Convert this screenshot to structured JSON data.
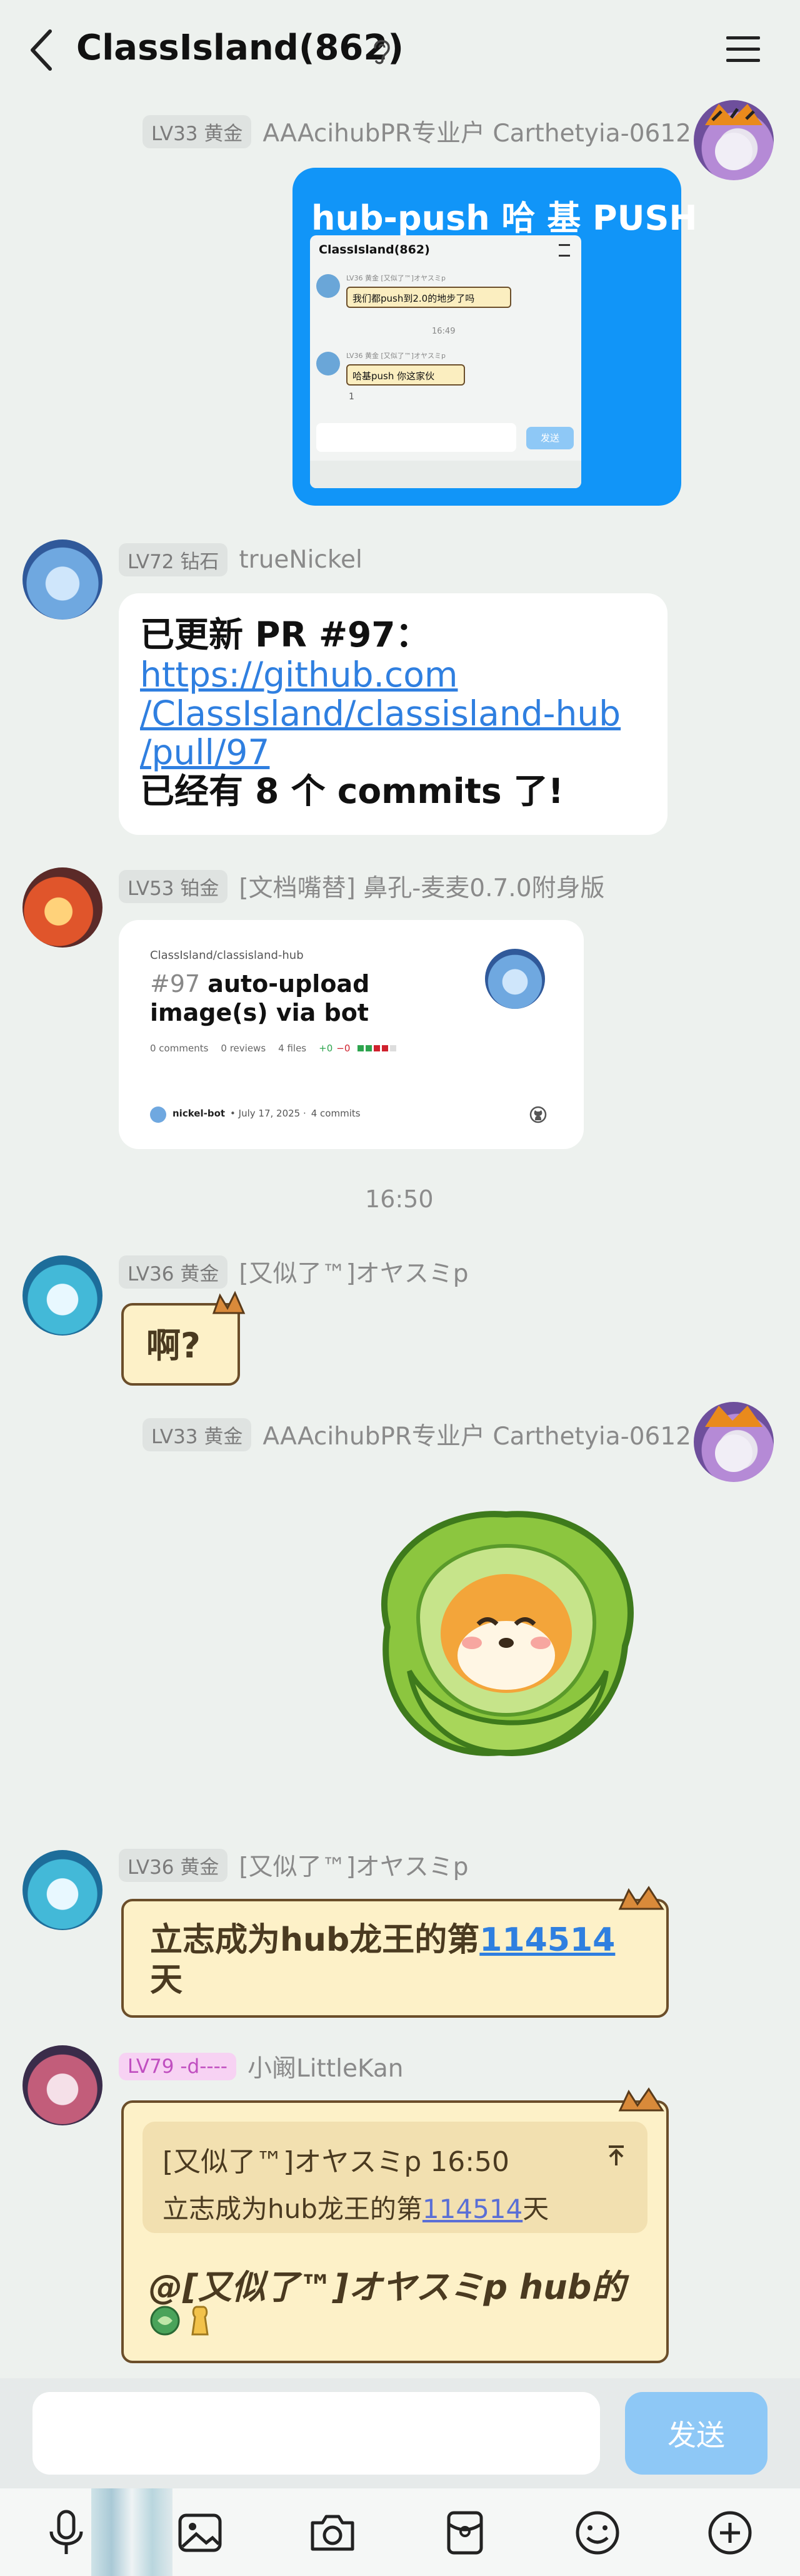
{
  "header": {
    "title": "ClassIsland(862)",
    "back_icon": "back-arrow-icon",
    "ear_icon": "ear-icon",
    "menu_icon": "hamburger-menu-icon"
  },
  "messages": [
    {
      "level": "LV33 黄金",
      "name": "AAAcihubPR专业户 Carthetyia-0612",
      "title": "hub-push 哈 基 PUSH",
      "preview": {
        "title": "ClassIsland(862)",
        "sender_a": "LV36 黄金 [又似了™]オヤスミp",
        "msg_a": "我们都push到2.0的地步了吗",
        "time": "16:49",
        "sender_b": "LV36 黄金 [又似了™]オヤスミp",
        "msg_b": "哈基push 你这家伙",
        "reaction": "1",
        "send": "发送"
      }
    },
    {
      "level": "LV72 钻石",
      "name": "trueNickel",
      "line1": "已更新 PR #97：",
      "link1": "https://github.com",
      "link2": "/ClassIsland/classisland-hub",
      "link3": "/pull/97",
      "line2": "已经有 8 个 commits 了!"
    },
    {
      "level": "LV53 铂金",
      "name": "[文档嘴替] 鼻孔-麦麦0.7.0附身版",
      "card": {
        "repo": "ClassIsland/classisland-hub",
        "number": "#97",
        "title_1": "auto-upload",
        "title_2": "image(s) via bot",
        "comments": "0 comments",
        "reviews": "0 reviews",
        "files": "4 files",
        "diff_add": "+0",
        "diff_del": "−0",
        "author": "nickel-bot",
        "date": "• July 17, 2025 ·",
        "commits": "4 commits"
      }
    },
    {
      "time": "16:50"
    },
    {
      "level": "LV36 黄金",
      "name": "[又似了™]オヤスミp",
      "text": "啊?"
    },
    {
      "level": "LV33 黄金",
      "name": "AAAcihubPR专业户 Carthetyia-0612"
    },
    {
      "level": "LV36 黄金",
      "name": "[又似了™]オヤスミp",
      "text_a": "立志成为hub龙王的第",
      "link": "114514",
      "text_b": "天"
    },
    {
      "level": "LV79 -d----",
      "name": "小阚LittleKan",
      "quote_head": "[又似了™]オヤスミp 16:50",
      "quote_a": "立志成为hub龙王的第",
      "quote_link": "114514",
      "quote_b": "天",
      "reply": "@[又似了™]オヤスミp hub的"
    }
  ],
  "composer": {
    "send_label": "发送",
    "tools": [
      "mic-icon",
      "image-icon",
      "camera-icon",
      "red-packet-icon",
      "emoji-icon",
      "plus-icon"
    ]
  },
  "colors": {
    "background": "#edf1ee",
    "blue_bubble": "#1195f8",
    "link": "#2f7fe0",
    "send_button": "#8ec8f6"
  }
}
